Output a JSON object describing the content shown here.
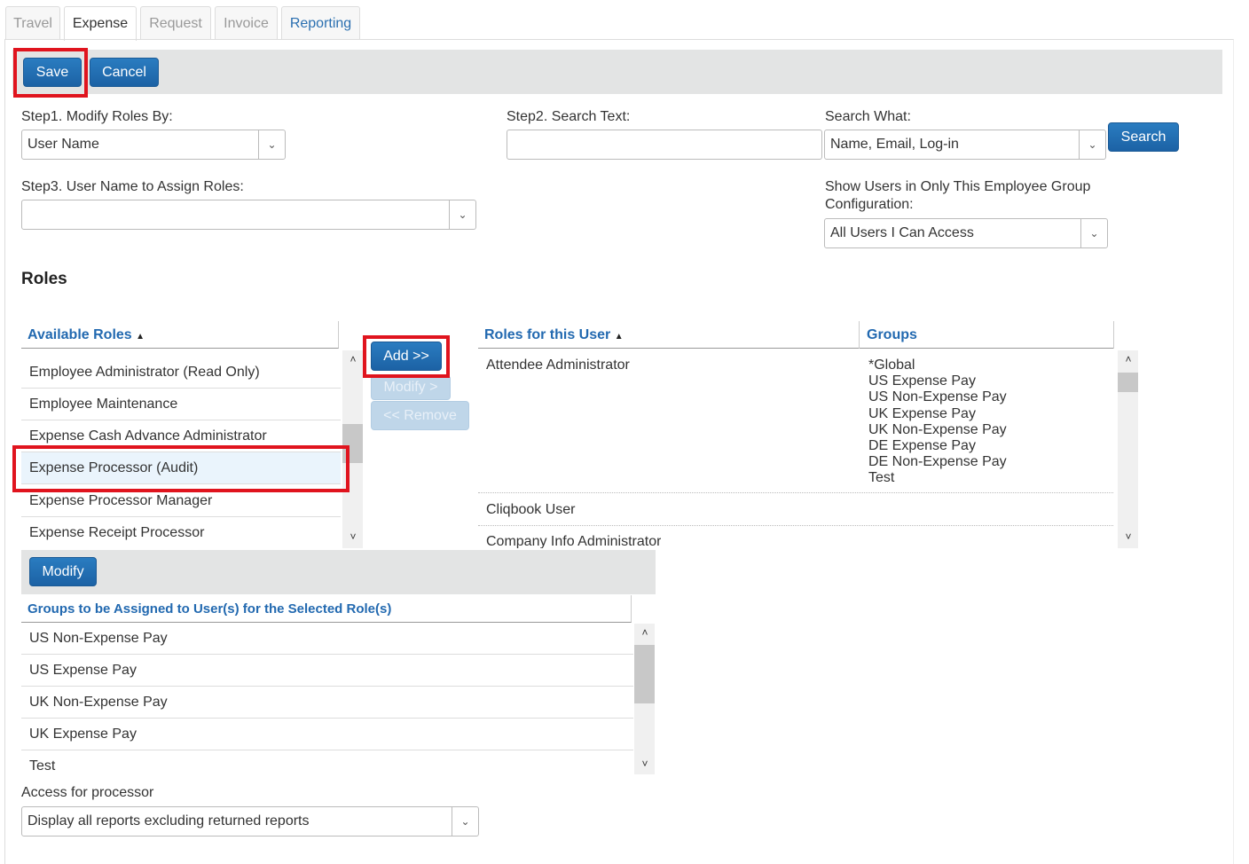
{
  "tabs": [
    "Travel",
    "Expense",
    "Request",
    "Invoice",
    "Reporting"
  ],
  "toolbar": {
    "save": "Save",
    "cancel": "Cancel"
  },
  "step1": {
    "label": "Step1. Modify Roles By:",
    "value": "User Name"
  },
  "step2": {
    "label": "Step2. Search Text:",
    "value": ""
  },
  "search_what": {
    "label": "Search What:",
    "value": "Name, Email, Log-in",
    "button": "Search"
  },
  "step3": {
    "label": "Step3. User Name to Assign Roles:",
    "value": ""
  },
  "group_filter": {
    "label_line1": "Show Users in Only This Employee Group",
    "label_line2": "Configuration:",
    "value": "All Users I Can Access"
  },
  "roles": {
    "title": "Roles",
    "available_header": "Available Roles",
    "sort_icon": "▲",
    "available": [
      "Employee Administrator (Read Only)",
      "Employee Maintenance",
      "Expense Cash Advance Administrator",
      "Expense Processor (Audit)",
      "Expense Processor Manager",
      "Expense Receipt Processor"
    ],
    "add": "Add >>",
    "modify": "Modify >",
    "remove": "<< Remove",
    "user_roles_header": "Roles for this User",
    "groups_header": "Groups",
    "user_roles": [
      {
        "role": "Attendee Administrator",
        "groups": [
          "*Global",
          "US Expense Pay",
          "US Non-Expense Pay",
          "UK Expense Pay",
          "UK Non-Expense Pay",
          "DE Expense Pay",
          "DE Non-Expense Pay",
          "Test"
        ]
      },
      {
        "role": "Cliqbook User",
        "groups": []
      },
      {
        "role": "Company Info Administrator",
        "groups": []
      }
    ]
  },
  "groups_section": {
    "modify": "Modify",
    "header": "Groups to be Assigned to User(s) for the Selected Role(s)",
    "items": [
      "US Non-Expense Pay",
      "US Expense Pay",
      "UK Non-Expense Pay",
      "UK Expense Pay",
      "Test"
    ]
  },
  "access": {
    "label": "Access for processor",
    "value": "Display all reports excluding returned reports"
  }
}
